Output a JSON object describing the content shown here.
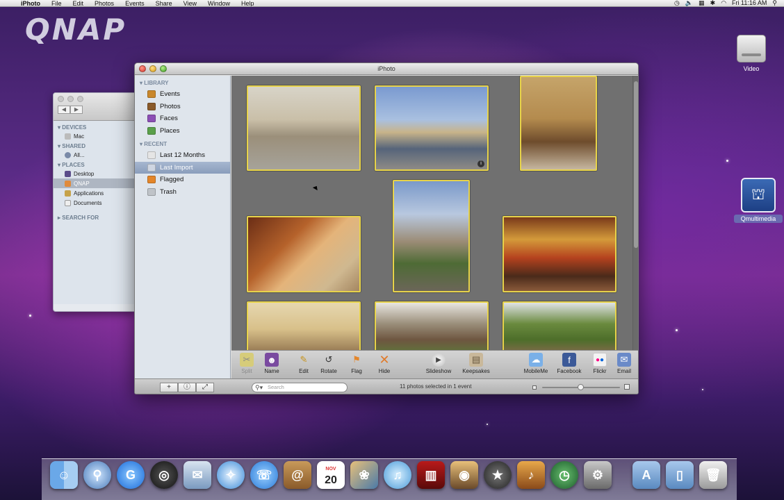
{
  "menubar": {
    "apple": "",
    "app": "iPhoto",
    "items": [
      "File",
      "Edit",
      "Photos",
      "Events",
      "Share",
      "View",
      "Window",
      "Help"
    ],
    "clock": "Fri 11:16 AM"
  },
  "desktop": {
    "logo": "QNAP",
    "icons": [
      {
        "label": "Video",
        "icon": "hard-disk-icon"
      },
      {
        "label": "Qmultimedia",
        "icon": "network-volume-icon"
      }
    ]
  },
  "finder": {
    "sections": [
      {
        "title": "DEVICES",
        "items": [
          "Mac"
        ]
      },
      {
        "title": "SHARED",
        "items": [
          "All..."
        ]
      },
      {
        "title": "PLACES",
        "items": [
          "Desktop",
          "QNAP",
          "Applications",
          "Documents"
        ]
      },
      {
        "title": "SEARCH FOR",
        "items": []
      }
    ],
    "selected": "QNAP"
  },
  "iphoto": {
    "title": "iPhoto",
    "library_header": "LIBRARY",
    "library": [
      "Events",
      "Photos",
      "Faces",
      "Places"
    ],
    "recent_header": "RECENT",
    "recent": [
      "Last 12 Months",
      "Last Import",
      "Flagged",
      "Trash"
    ],
    "selected": "Last Import",
    "toolbar": {
      "split": "Split",
      "name": "Name",
      "edit": "Edit",
      "rotate": "Rotate",
      "flag": "Flag",
      "hide": "Hide",
      "slideshow": "Slideshow",
      "keepsakes": "Keepsakes",
      "mobileme": "MobileMe",
      "facebook": "Facebook",
      "flickr": "Flickr",
      "email": "Email"
    },
    "search_placeholder": "Search",
    "status": "11 photos selected in 1 event",
    "zoom_level": 0.5,
    "colors": {
      "selection": "#e7d34a",
      "content_bg": "#707070"
    }
  },
  "dock": {
    "apps": [
      "Finder",
      "Spotlight",
      "Google",
      "Dashboard",
      "Mail",
      "Safari",
      "iChat",
      "Address Book",
      "iCal",
      "iPhoto",
      "iTunes",
      "Front Row",
      "Photo Booth",
      "iMovie",
      "GarageBand",
      "Time Machine",
      "System Preferences",
      "Applications",
      "Documents",
      "Trash"
    ],
    "ical_day": "20",
    "ical_month": "NOV"
  }
}
